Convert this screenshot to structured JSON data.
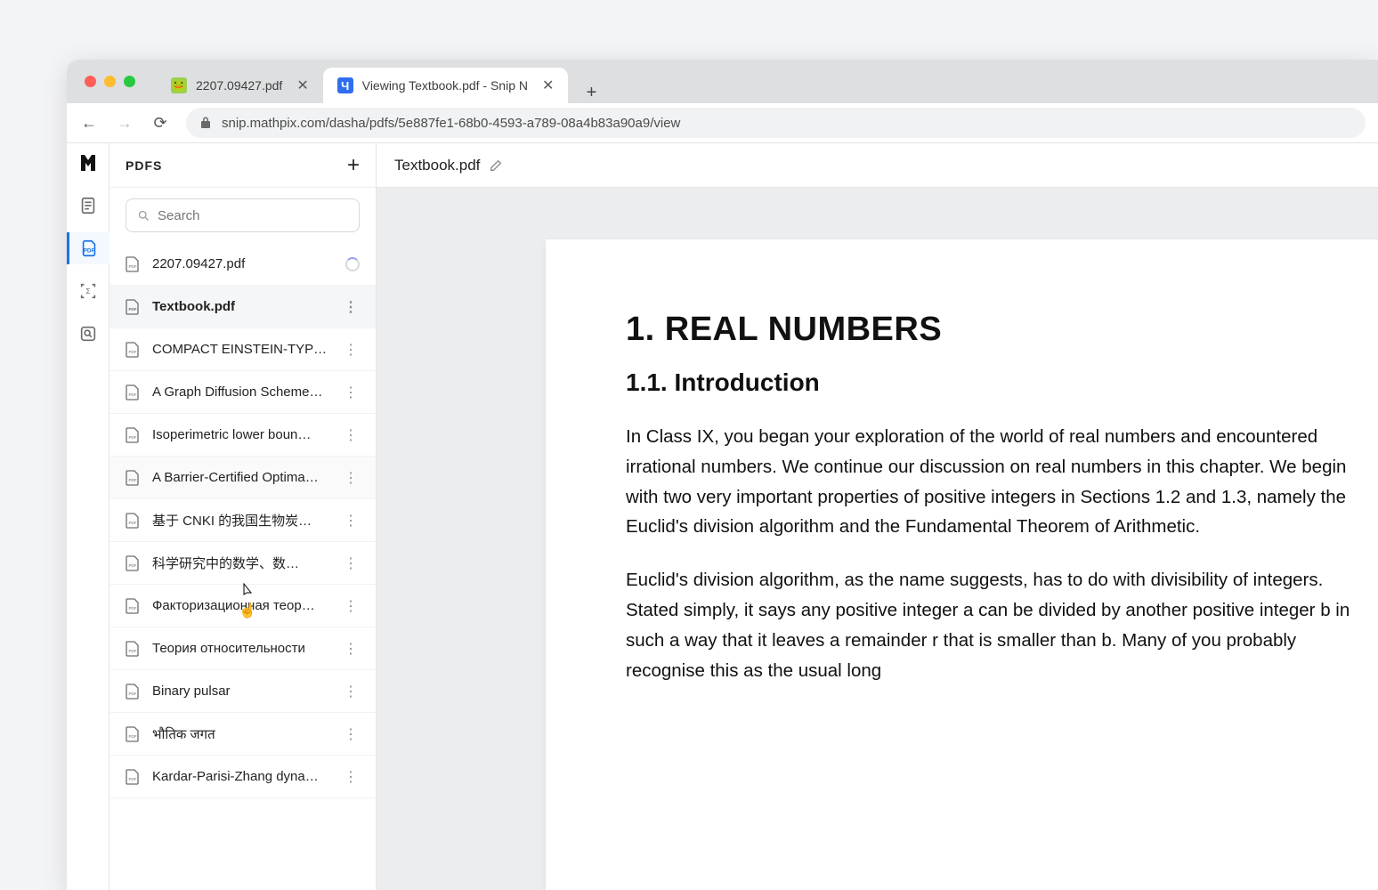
{
  "browser": {
    "tabs": [
      {
        "label": "2207.09427.pdf",
        "favicon_bg": "#9bd14b"
      },
      {
        "label": "Viewing Textbook.pdf - Snip N",
        "favicon_bg": "#2f6fef"
      }
    ],
    "url": "snip.mathpix.com/dasha/pdfs/5e887fe1-68b0-4593-a789-08a4b83a90a9/view"
  },
  "sidebar": {
    "title": "PDFS",
    "search_placeholder": "Search",
    "files": [
      {
        "name": "2207.09427.pdf",
        "status": "loading"
      },
      {
        "name": "Textbook.pdf",
        "status": "selected"
      },
      {
        "name": "COMPACT EINSTEIN-TYPE …"
      },
      {
        "name": "A Graph Diffusion Scheme…"
      },
      {
        "name": "Isoperimetric lower boun…"
      },
      {
        "name": "A Barrier-Certified Optima…"
      },
      {
        "name": "基于 CNKI 的我国生物炭…"
      },
      {
        "name": "科学研究中的数学、数…"
      },
      {
        "name": "Факторизационная теор…"
      },
      {
        "name": "Теория относительности"
      },
      {
        "name": "Binary pulsar"
      },
      {
        "name": "भौतिक जगत"
      },
      {
        "name": "Kardar-Parisi-Zhang dyna…"
      }
    ]
  },
  "document": {
    "title": "Textbook.pdf",
    "h1": "1. REAL NUMBERS",
    "h2": "1.1. Introduction",
    "p1": "In Class IX, you began your exploration of the world of real numbers and encountered irrational numbers. We continue our discussion on real numbers in this chapter. We begin with two very important properties of positive integers in Sections 1.2 and 1.3, namely the Euclid's division algorithm and the Fundamental Theorem of Arithmetic.",
    "p2": "Euclid's division algorithm, as the name suggests, has to do with divisibility of integers. Stated simply, it says any positive integer a can be divided by another positive integer b in such a way that it leaves a remainder r that is smaller than b. Many of you probably recognise this as the usual long"
  },
  "rail": {
    "items": [
      "logo",
      "doc",
      "pdf",
      "scan",
      "search"
    ]
  }
}
